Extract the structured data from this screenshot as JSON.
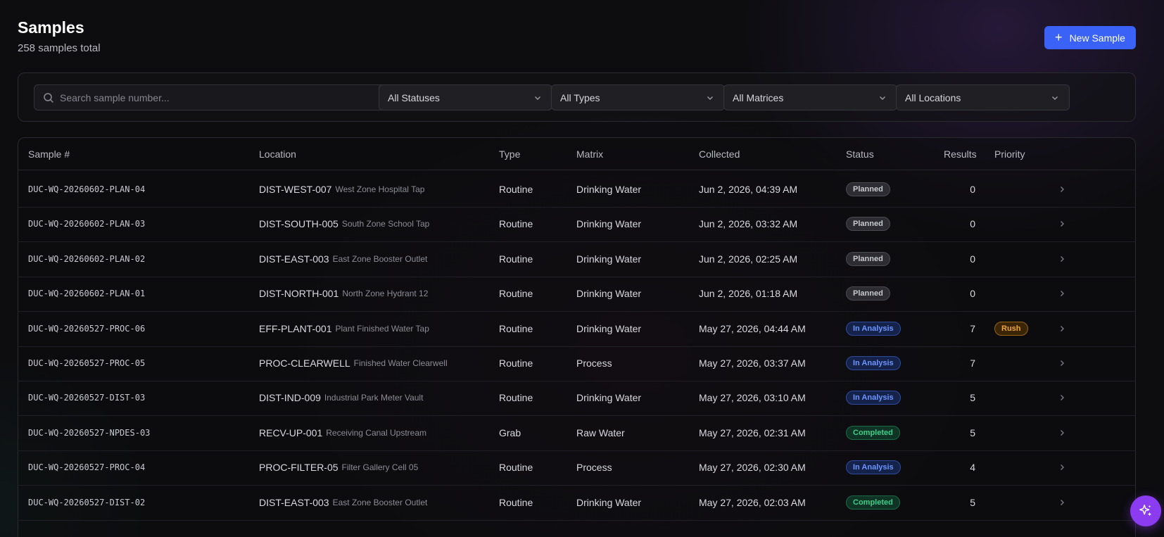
{
  "header": {
    "title": "Samples",
    "subtitle": "258 samples total",
    "new_button_label": "New Sample"
  },
  "filters": {
    "search_placeholder": "Search sample number...",
    "status": "All Statuses",
    "type": "All Types",
    "matrix": "All Matrices",
    "location": "All Locations"
  },
  "table": {
    "columns": {
      "sample": "Sample #",
      "location": "Location",
      "type": "Type",
      "matrix": "Matrix",
      "collected": "Collected",
      "status": "Status",
      "results": "Results",
      "priority": "Priority"
    },
    "rows": [
      {
        "sample": "DUC-WQ-20260602-PLAN-04",
        "loc_code": "DIST-WEST-007",
        "loc_name": "West Zone Hospital Tap",
        "type": "Routine",
        "matrix": "Drinking Water",
        "collected": "Jun 2, 2026, 04:39 AM",
        "status": "Planned",
        "results": "0",
        "priority": ""
      },
      {
        "sample": "DUC-WQ-20260602-PLAN-03",
        "loc_code": "DIST-SOUTH-005",
        "loc_name": "South Zone School Tap",
        "type": "Routine",
        "matrix": "Drinking Water",
        "collected": "Jun 2, 2026, 03:32 AM",
        "status": "Planned",
        "results": "0",
        "priority": ""
      },
      {
        "sample": "DUC-WQ-20260602-PLAN-02",
        "loc_code": "DIST-EAST-003",
        "loc_name": "East Zone Booster Outlet",
        "type": "Routine",
        "matrix": "Drinking Water",
        "collected": "Jun 2, 2026, 02:25 AM",
        "status": "Planned",
        "results": "0",
        "priority": ""
      },
      {
        "sample": "DUC-WQ-20260602-PLAN-01",
        "loc_code": "DIST-NORTH-001",
        "loc_name": "North Zone Hydrant 12",
        "type": "Routine",
        "matrix": "Drinking Water",
        "collected": "Jun 2, 2026, 01:18 AM",
        "status": "Planned",
        "results": "0",
        "priority": ""
      },
      {
        "sample": "DUC-WQ-20260527-PROC-06",
        "loc_code": "EFF-PLANT-001",
        "loc_name": "Plant Finished Water Tap",
        "type": "Routine",
        "matrix": "Drinking Water",
        "collected": "May 27, 2026, 04:44 AM",
        "status": "In Analysis",
        "results": "7",
        "priority": "Rush"
      },
      {
        "sample": "DUC-WQ-20260527-PROC-05",
        "loc_code": "PROC-CLEARWELL",
        "loc_name": "Finished Water Clearwell",
        "type": "Routine",
        "matrix": "Process",
        "collected": "May 27, 2026, 03:37 AM",
        "status": "In Analysis",
        "results": "7",
        "priority": ""
      },
      {
        "sample": "DUC-WQ-20260527-DIST-03",
        "loc_code": "DIST-IND-009",
        "loc_name": "Industrial Park Meter Vault",
        "type": "Routine",
        "matrix": "Drinking Water",
        "collected": "May 27, 2026, 03:10 AM",
        "status": "In Analysis",
        "results": "5",
        "priority": ""
      },
      {
        "sample": "DUC-WQ-20260527-NPDES-03",
        "loc_code": "RECV-UP-001",
        "loc_name": "Receiving Canal Upstream",
        "type": "Grab",
        "matrix": "Raw Water",
        "collected": "May 27, 2026, 02:31 AM",
        "status": "Completed",
        "results": "5",
        "priority": ""
      },
      {
        "sample": "DUC-WQ-20260527-PROC-04",
        "loc_code": "PROC-FILTER-05",
        "loc_name": "Filter Gallery Cell 05",
        "type": "Routine",
        "matrix": "Process",
        "collected": "May 27, 2026, 02:30 AM",
        "status": "In Analysis",
        "results": "4",
        "priority": ""
      },
      {
        "sample": "DUC-WQ-20260527-DIST-02",
        "loc_code": "DIST-EAST-003",
        "loc_name": "East Zone Booster Outlet",
        "type": "Routine",
        "matrix": "Drinking Water",
        "collected": "May 27, 2026, 02:03 AM",
        "status": "Completed",
        "results": "5",
        "priority": ""
      }
    ]
  },
  "icons": {
    "search": "search-icon",
    "chevron_down": "chevron-down-icon",
    "chevron_right": "chevron-right-icon",
    "plus": "plus-icon",
    "sparkles": "sparkles-icon"
  },
  "colors": {
    "accent": "#3b62f6",
    "fab": "#8b3cf0",
    "planned": "#c8c8cf",
    "in_analysis": "#6d95ff",
    "completed": "#3ed08a",
    "rush": "#f0a53a"
  }
}
